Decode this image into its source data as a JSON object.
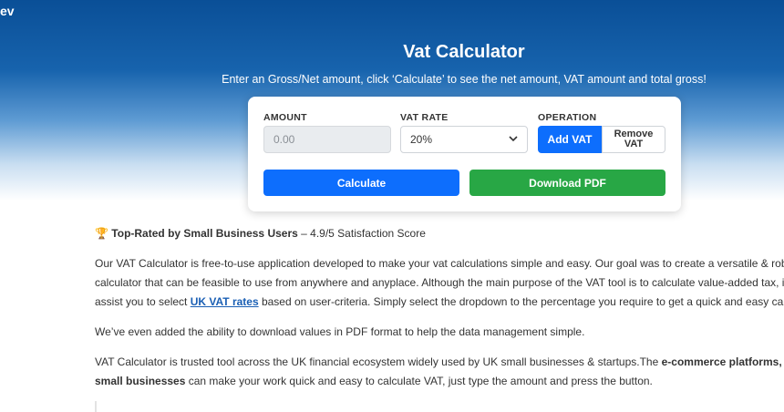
{
  "brand": "ev",
  "hero": {
    "title": "Vat Calculator",
    "subtitle": "Enter an Gross/Net amount, click ‘Calculate’ to see the net amount, VAT amount and total gross!"
  },
  "form": {
    "amount_label": "AMOUNT",
    "amount_placeholder": "0.00",
    "vat_rate_label": "VAT RATE",
    "vat_rate_selected": "20%",
    "operation_label": "OPERATION",
    "add_vat_label": "Add VAT",
    "remove_vat_label": "Remove VAT",
    "calculate_label": "Calculate",
    "download_label": "Download PDF"
  },
  "content": {
    "rating_title": "Top-Rated by Small Business Users",
    "rating_score": " – 4.9/5 Satisfaction Score",
    "p1_line1": "Our VAT Calculator is free-to-use application developed to make your vat calculations simple and easy. Our goal was to create a versatile & robust ta",
    "p1_line2": "calculator that can be feasible to use from anywhere and anyplace. Although the main purpose of the VAT tool is to calculate value-added tax, it can",
    "p1_line3_pre": "assist you to select ",
    "p1_link": "UK VAT rates",
    "p1_line3_post": " based on user-criteria. Simply select the dropdown to the percentage you require to get a quick and easy calculati",
    "p2": "We’ve even added the ability to download values in PDF format to help the data management simple.",
    "p3_line1_pre": "VAT Calculator is trusted tool across the UK financial ecosystem widely used by UK small businesses & startups.The ",
    "p3_line1_bold": "e-commerce platforms, freelan",
    "p3_line2_bold": "small businesses",
    "p3_line2_post": " can make your work quick and easy to calculate VAT, just type the amount and press the button."
  },
  "icons": {
    "trophy": "trophy-icon",
    "chevron": "chevron-down-icon"
  },
  "colors": {
    "primary": "#0d6efd",
    "success": "#28a745",
    "hero": "#0a4f97"
  }
}
